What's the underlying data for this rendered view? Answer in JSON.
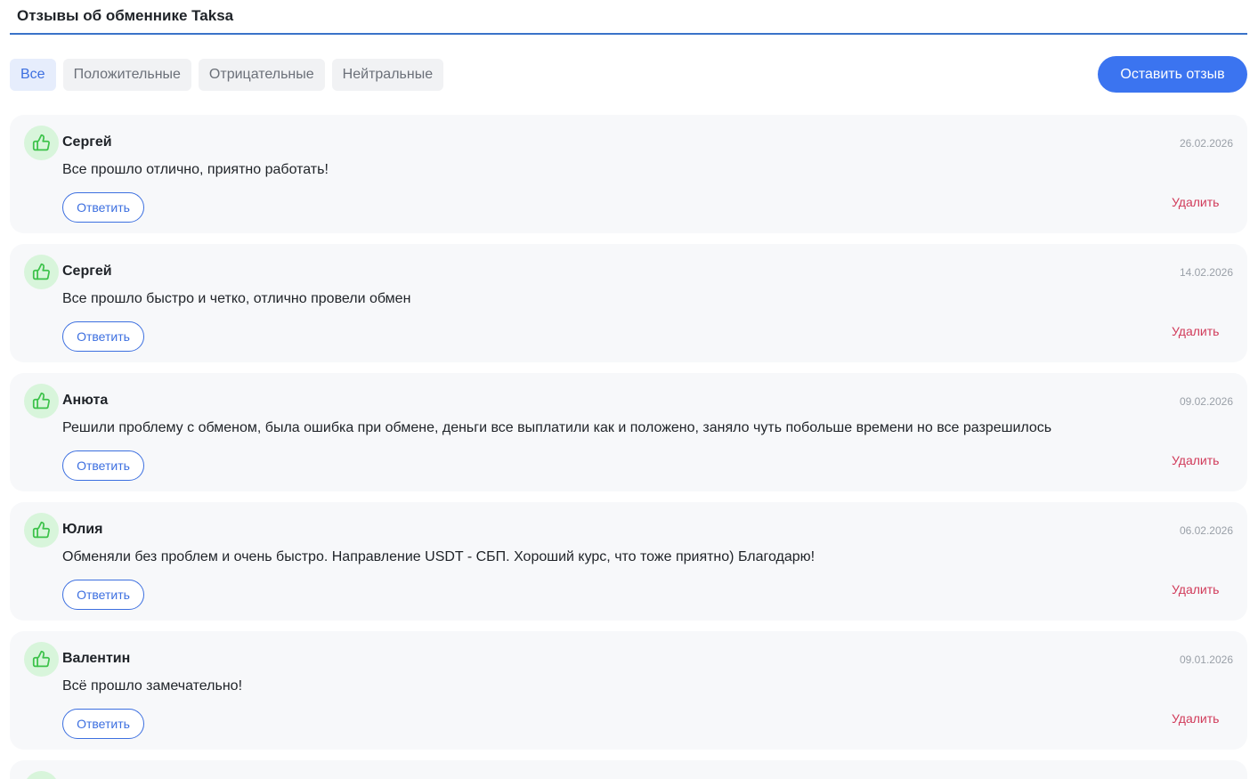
{
  "header": {
    "title": "Отзывы об обменнике Taksa"
  },
  "filters": [
    {
      "label": "Все",
      "active": true
    },
    {
      "label": "Положительные",
      "active": false
    },
    {
      "label": "Отрицательные",
      "active": false
    },
    {
      "label": "Нейтральные",
      "active": false
    }
  ],
  "leave_review_label": "Оставить отзыв",
  "icons": {
    "review_rating": "thumbs-up-icon"
  },
  "colors": {
    "accent": "#3b74f0",
    "positive_icon": "#3cc24a",
    "positive_bg": "#d8f5db",
    "delete": "#d13b5a"
  },
  "reviews": [
    {
      "author": "Сергей",
      "date": "26.02.2026",
      "text": "Все прошло отлично, приятно работать!",
      "reply_label": "Ответить",
      "delete_label": "Удалить"
    },
    {
      "author": "Сергей",
      "date": "14.02.2026",
      "text": "Все прошло быстро и четко, отлично провели обмен",
      "reply_label": "Ответить",
      "delete_label": "Удалить"
    },
    {
      "author": "Анюта",
      "date": "09.02.2026",
      "text": "Решили проблему с обменом, была ошибка при обмене, деньги все выплатили как и положено, заняло чуть побольше времени но все разрешилось",
      "reply_label": "Ответить",
      "delete_label": "Удалить"
    },
    {
      "author": "Юлия",
      "date": "06.02.2026",
      "text": "Обменяли без проблем и очень быстро. Направление USDT - СБП. Хороший курс, что тоже приятно) Благодарю!",
      "reply_label": "Ответить",
      "delete_label": "Удалить"
    },
    {
      "author": "Валентин",
      "date": "09.01.2026",
      "text": "Всё прошло замечательно!",
      "reply_label": "Ответить",
      "delete_label": "Удалить"
    }
  ]
}
